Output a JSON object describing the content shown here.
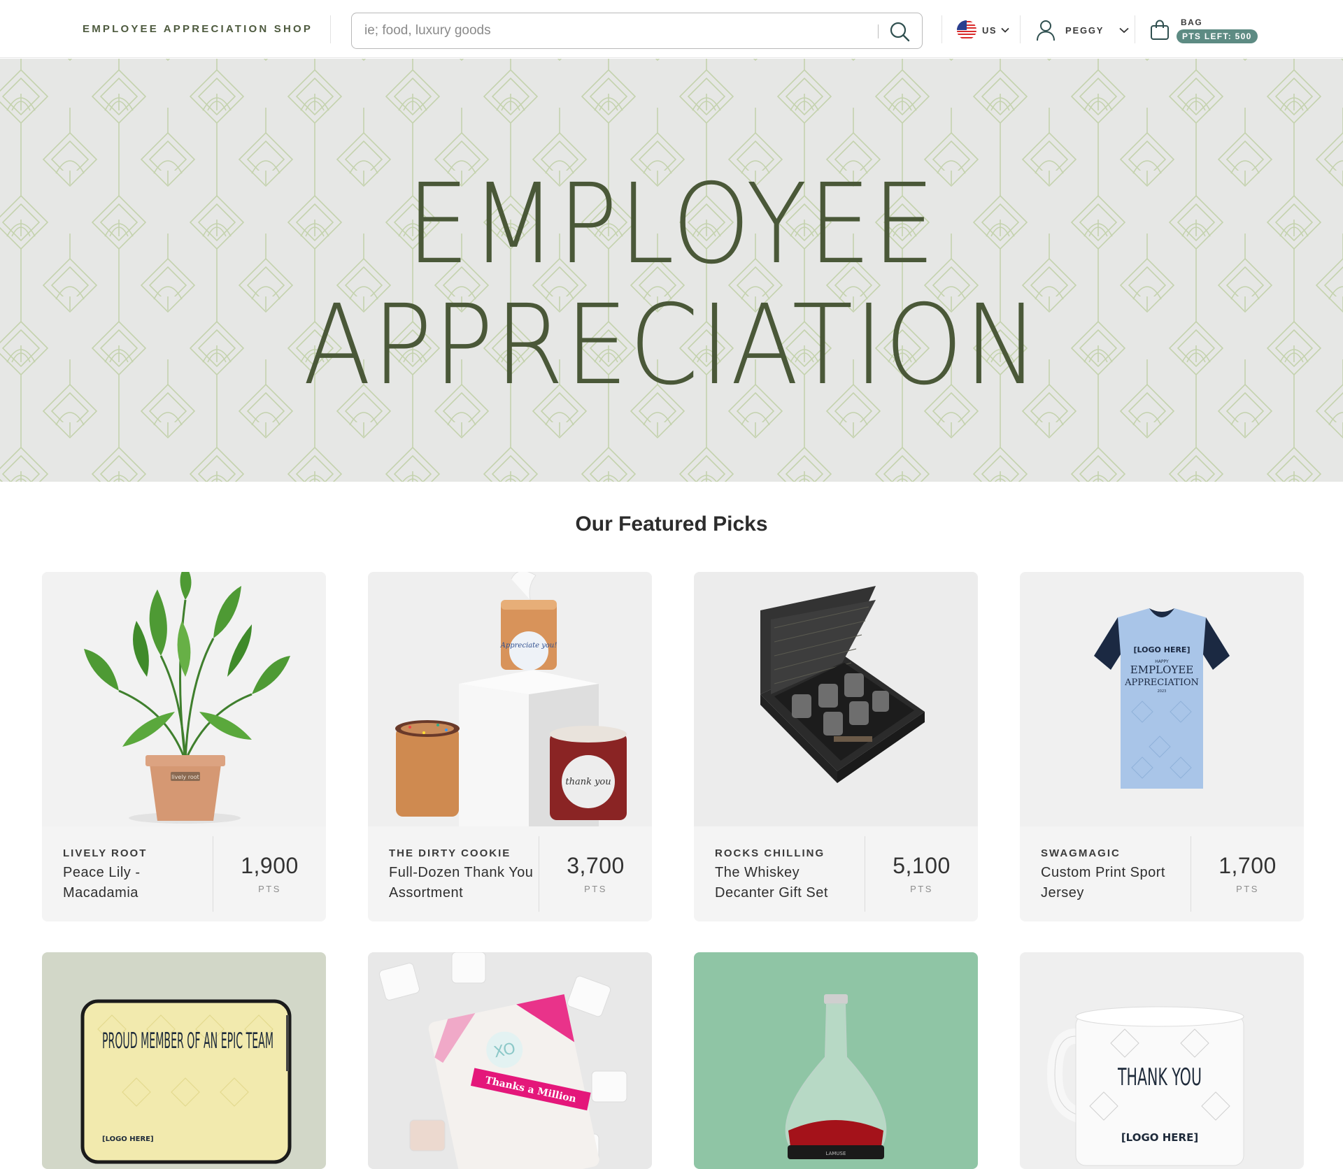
{
  "header": {
    "brand": "EMPLOYEE APPRECIATION SHOP",
    "search_placeholder": "ie; food, luxury goods",
    "locale_label": "US",
    "user_label": "PEGGY",
    "bag_label": "BAG",
    "points_left": "PTS LEFT: 500"
  },
  "hero": {
    "line1": "EMPLOYEE",
    "line2": "APPRECIATION"
  },
  "featured": {
    "title": "Our Featured Picks",
    "products": [
      {
        "vendor": "LIVELY ROOT",
        "name": "Peace Lily - Macadamia",
        "price": "1,900",
        "unit": "PTS"
      },
      {
        "vendor": "THE DIRTY COOKIE",
        "name": "Full-Dozen Thank You Assortment",
        "price": "3,700",
        "unit": "PTS"
      },
      {
        "vendor": "ROCKS CHILLING",
        "name": "The Whiskey Decanter Gift Set",
        "price": "5,100",
        "unit": "PTS"
      },
      {
        "vendor": "SWAGMAGIC",
        "name": "Custom Print Sport Jersey",
        "price": "1,700",
        "unit": "PTS"
      }
    ],
    "more_products": [
      {
        "image_text": "PROUD MEMBER OF AN EPIC TEAM",
        "logo_text": "[LOGO HERE]"
      },
      {
        "image_text": "Thanks a Million",
        "badge_text": "XO"
      },
      {
        "image_text": "LAMUSE"
      },
      {
        "image_text": "THANK YOU",
        "logo_text": "[LOGO HERE]"
      }
    ]
  },
  "product_images": {
    "plant_pot_label": "lively root",
    "cookie_label_1": "Appreciate you!",
    "cookie_label_2": "thank you",
    "jersey_logo": "[LOGO HERE]",
    "jersey_small": "HAPPY",
    "jersey_text_1": "EMPLOYEE",
    "jersey_text_2": "APPRECIATION",
    "jersey_year": "2023"
  },
  "colors": {
    "brand_green": "#4a5838",
    "points_badge": "#5d8b83",
    "hero_bg": "#e6e7e5",
    "card_bg": "#f4f4f4",
    "decanter_bg": "#8fc5a5"
  },
  "icons": [
    "search-icon",
    "us-flag-icon",
    "chevron-down-icon",
    "user-icon",
    "shopping-bag-icon"
  ]
}
